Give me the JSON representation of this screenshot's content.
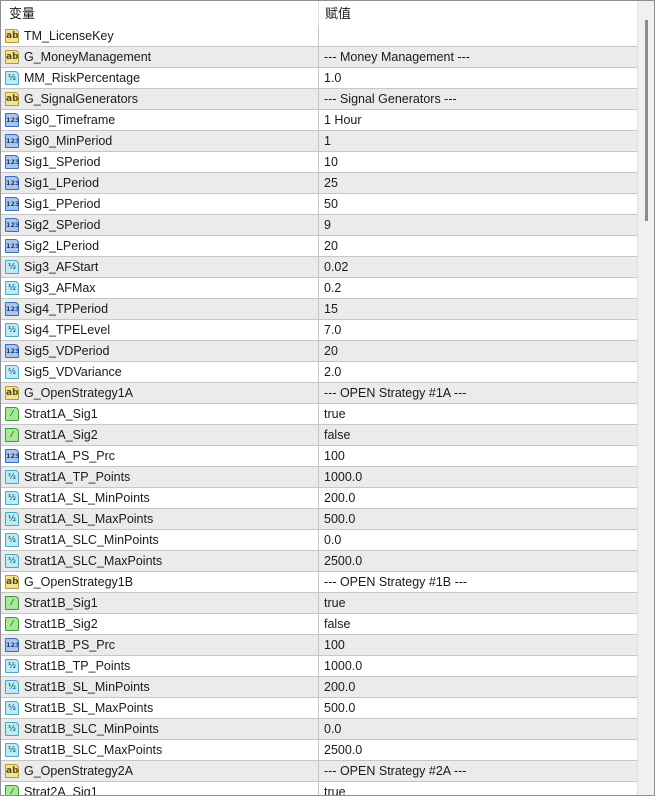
{
  "header": {
    "col_variable": "变量",
    "col_value": "赋值"
  },
  "rows": [
    {
      "type": "string",
      "name": "TM_LicenseKey",
      "value": ""
    },
    {
      "type": "string",
      "name": "G_MoneyManagement",
      "value": "--- Money Management ---"
    },
    {
      "type": "double",
      "name": "MM_RiskPercentage",
      "value": "1.0"
    },
    {
      "type": "string",
      "name": "G_SignalGenerators",
      "value": "--- Signal Generators ---"
    },
    {
      "type": "int",
      "name": "Sig0_Timeframe",
      "value": "1 Hour"
    },
    {
      "type": "int",
      "name": "Sig0_MinPeriod",
      "value": "1"
    },
    {
      "type": "int",
      "name": "Sig1_SPeriod",
      "value": "10"
    },
    {
      "type": "int",
      "name": "Sig1_LPeriod",
      "value": "25"
    },
    {
      "type": "int",
      "name": "Sig1_PPeriod",
      "value": "50"
    },
    {
      "type": "int",
      "name": "Sig2_SPeriod",
      "value": "9"
    },
    {
      "type": "int",
      "name": "Sig2_LPeriod",
      "value": "20"
    },
    {
      "type": "double",
      "name": "Sig3_AFStart",
      "value": "0.02"
    },
    {
      "type": "double",
      "name": "Sig3_AFMax",
      "value": "0.2"
    },
    {
      "type": "int",
      "name": "Sig4_TPPeriod",
      "value": "15"
    },
    {
      "type": "double",
      "name": "Sig4_TPELevel",
      "value": "7.0"
    },
    {
      "type": "int",
      "name": "Sig5_VDPeriod",
      "value": "20"
    },
    {
      "type": "double",
      "name": "Sig5_VDVariance",
      "value": "2.0"
    },
    {
      "type": "string",
      "name": "G_OpenStrategy1A",
      "value": "--- OPEN Strategy #1A ---"
    },
    {
      "type": "bool",
      "name": "Strat1A_Sig1",
      "value": "true"
    },
    {
      "type": "bool",
      "name": "Strat1A_Sig2",
      "value": "false"
    },
    {
      "type": "int",
      "name": "Strat1A_PS_Prc",
      "value": "100"
    },
    {
      "type": "double",
      "name": "Strat1A_TP_Points",
      "value": "1000.0"
    },
    {
      "type": "double",
      "name": "Strat1A_SL_MinPoints",
      "value": "200.0"
    },
    {
      "type": "double",
      "name": "Strat1A_SL_MaxPoints",
      "value": "500.0"
    },
    {
      "type": "double",
      "name": "Strat1A_SLC_MinPoints",
      "value": "0.0"
    },
    {
      "type": "double",
      "name": "Strat1A_SLC_MaxPoints",
      "value": "2500.0"
    },
    {
      "type": "string",
      "name": "G_OpenStrategy1B",
      "value": "--- OPEN Strategy #1B ---"
    },
    {
      "type": "bool",
      "name": "Strat1B_Sig1",
      "value": "true"
    },
    {
      "type": "bool",
      "name": "Strat1B_Sig2",
      "value": "false"
    },
    {
      "type": "int",
      "name": "Strat1B_PS_Prc",
      "value": "100"
    },
    {
      "type": "double",
      "name": "Strat1B_TP_Points",
      "value": "1000.0"
    },
    {
      "type": "double",
      "name": "Strat1B_SL_MinPoints",
      "value": "200.0"
    },
    {
      "type": "double",
      "name": "Strat1B_SL_MaxPoints",
      "value": "500.0"
    },
    {
      "type": "double",
      "name": "Strat1B_SLC_MinPoints",
      "value": "0.0"
    },
    {
      "type": "double",
      "name": "Strat1B_SLC_MaxPoints",
      "value": "2500.0"
    },
    {
      "type": "string",
      "name": "G_OpenStrategy2A",
      "value": "--- OPEN Strategy #2A ---"
    },
    {
      "type": "bool",
      "name": "Strat2A_Sig1",
      "value": "true"
    }
  ],
  "icon_glyphs": {
    "string": "ab",
    "double": "½",
    "int": "123",
    "bool": "⁄"
  }
}
